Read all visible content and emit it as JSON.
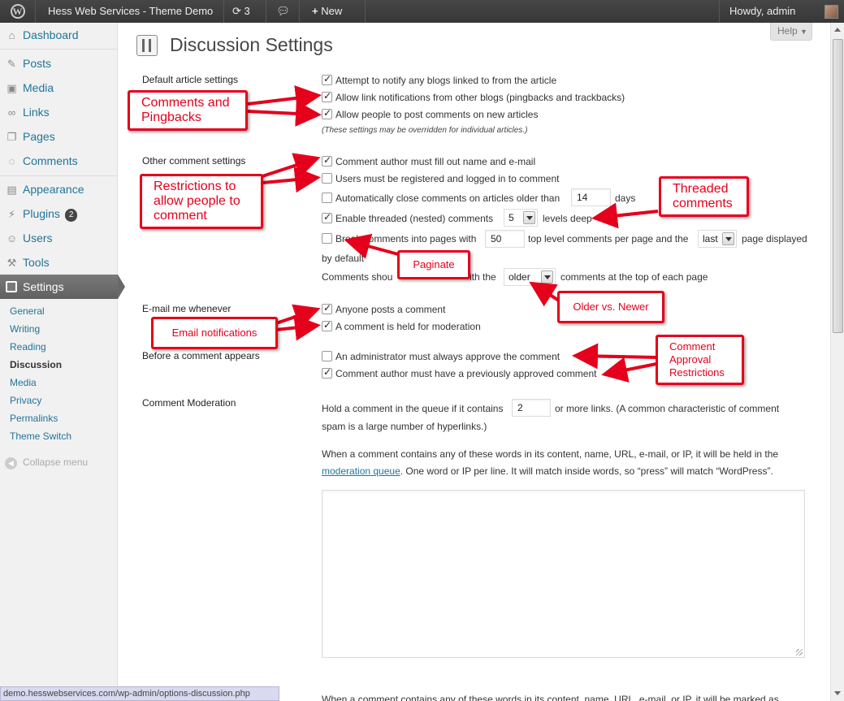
{
  "adminbar": {
    "site_title": "Hess Web Services - Theme Demo",
    "updates_count": "3",
    "new_label": "New",
    "howdy": "Howdy, admin"
  },
  "sidebar": {
    "items": [
      {
        "label": "Dashboard",
        "icon": "dashboard-icon"
      },
      {
        "label": "Posts",
        "icon": "pin-icon"
      },
      {
        "label": "Media",
        "icon": "media-icon"
      },
      {
        "label": "Links",
        "icon": "link-icon"
      },
      {
        "label": "Pages",
        "icon": "pages-icon"
      },
      {
        "label": "Comments",
        "icon": "comments-icon"
      },
      {
        "label": "Appearance",
        "icon": "appearance-icon"
      },
      {
        "label": "Plugins",
        "icon": "plugins-icon",
        "badge": "2"
      },
      {
        "label": "Users",
        "icon": "users-icon"
      },
      {
        "label": "Tools",
        "icon": "tools-icon"
      },
      {
        "label": "Settings",
        "icon": "settings-icon"
      }
    ],
    "submenu": [
      "General",
      "Writing",
      "Reading",
      "Discussion",
      "Media",
      "Privacy",
      "Permalinks",
      "Theme Switch"
    ],
    "collapse": "Collapse menu"
  },
  "page": {
    "title": "Discussion Settings",
    "help": "Help"
  },
  "sections": {
    "default_article": {
      "label": "Default article settings",
      "options": [
        {
          "text": "Attempt to notify any blogs linked to from the article",
          "checked": true
        },
        {
          "text": "Allow link notifications from other blogs (pingbacks and trackbacks)",
          "checked": true
        },
        {
          "text": "Allow people to post comments on new articles",
          "checked": true
        }
      ],
      "note": "(These settings may be overridden for individual articles.)"
    },
    "other_comment": {
      "label": "Other comment settings",
      "opt1": "Comment author must fill out name and e-mail",
      "opt2": "Users must be registered and logged in to comment",
      "opt3_pre": "Automatically close comments on articles older than",
      "opt3_value": "14",
      "opt3_post": "days",
      "opt4_pre": "Enable threaded (nested) comments",
      "opt4_value": "5",
      "opt4_post": "levels deep",
      "opt5_pre": "Break comments into pages with",
      "opt5_value": "50",
      "opt5_mid": "top level comments per page and the",
      "opt5_select": "last",
      "opt5_post": "page displayed",
      "opt5_line2": "by default",
      "opt6_pre": "Comments shou",
      "opt6_mid": "ith the",
      "opt6_select": "older",
      "opt6_post": "comments at the top of each page"
    },
    "email": {
      "label": "E-mail me whenever",
      "opt1": "Anyone posts a comment",
      "opt2": "A comment is held for moderation"
    },
    "before": {
      "label": "Before a comment appears",
      "opt1": "An administrator must always approve the comment",
      "opt2": "Comment author must have a previously approved comment"
    },
    "moderation": {
      "label": "Comment Moderation",
      "hold_pre": "Hold a comment in the queue if it contains",
      "hold_value": "2",
      "hold_post": "or more links. (A common characteristic of comment",
      "hold_line2": "spam is a large number of hyperlinks.)",
      "words_line1": "When a comment contains any of these words in its content, name, URL, e-mail, or IP, it will be held in the",
      "words_link": "moderation queue",
      "words_line2_post": ". One word or IP per line. It will match inside words, so “press” will match “WordPress”.",
      "bottom_line": "When a comment contains any of these words in its content, name, URL, e-mail, or IP, it will be marked as"
    }
  },
  "callouts": {
    "comments_pingbacks": "Comments and Pingbacks",
    "restrictions": "Restrictions to allow people to comment",
    "threaded": "Threaded comments",
    "paginate": "Paginate",
    "older_newer": "Older vs. Newer",
    "email_notifications": "Email notifications",
    "approval": "Comment Approval Restrictions"
  },
  "statusbar": "demo.hesswebservices.com/wp-admin/options-discussion.php",
  "colors": {
    "accent": "#21759b",
    "annotation": "#e5001b",
    "adminbar": "#464646"
  }
}
